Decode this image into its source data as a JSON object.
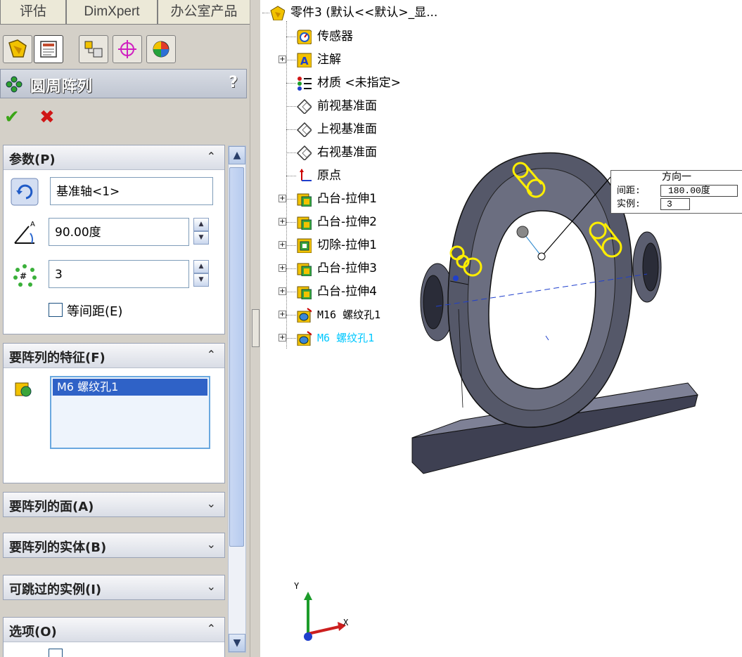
{
  "tabs": [
    "评估",
    "DimXpert",
    "办公室产品"
  ],
  "manager_icons": [
    "feature-manager-icon",
    "property-manager-icon",
    "configuration-manager-icon",
    "dimxpert-manager-icon",
    "display-manager-icon"
  ],
  "property_manager": {
    "title": "圆周阵列",
    "help": "?",
    "ok_glyph": "✔",
    "cancel_glyph": "✖",
    "parameters": {
      "header": "参数(P)",
      "axis_value": "基准轴<1>",
      "angle_value": "90.00度",
      "instances_value": "3",
      "equal_spacing_label": "等间距(E)",
      "equal_spacing_checked": false
    },
    "features_group": {
      "header": "要阵列的特征(F)",
      "items": [
        "M6 螺纹孔1"
      ]
    },
    "faces_group": {
      "header": "要阵列的面(A)"
    },
    "bodies_group": {
      "header": "要阵列的实体(B)"
    },
    "skip_group": {
      "header": "可跳过的实例(I)"
    },
    "options_group": {
      "header": "选项(O)"
    },
    "collapse_glyph": "⌃",
    "expand_glyph": "⌄"
  },
  "tree": {
    "root": "零件3  (默认<<默认>_显...",
    "items": [
      {
        "label": "传感器",
        "icon": "sensor-icon",
        "expandable": false
      },
      {
        "label": "注解",
        "icon": "annotation-icon",
        "expandable": true
      },
      {
        "label": "材质 <未指定>",
        "icon": "material-icon",
        "expandable": false
      },
      {
        "label": "前视基准面",
        "icon": "plane-icon",
        "expandable": false
      },
      {
        "label": "上视基准面",
        "icon": "plane-icon",
        "expandable": false
      },
      {
        "label": "右视基准面",
        "icon": "plane-icon",
        "expandable": false
      },
      {
        "label": "原点",
        "icon": "origin-icon",
        "expandable": false
      },
      {
        "label": "凸台-拉伸1",
        "icon": "boss-extrude-icon",
        "expandable": true
      },
      {
        "label": "凸台-拉伸2",
        "icon": "boss-extrude-icon",
        "expandable": true
      },
      {
        "label": "切除-拉伸1",
        "icon": "cut-extrude-icon",
        "expandable": true
      },
      {
        "label": "凸台-拉伸3",
        "icon": "boss-extrude-icon",
        "expandable": true
      },
      {
        "label": "凸台-拉伸4",
        "icon": "boss-extrude-icon",
        "expandable": true
      },
      {
        "label": "M16 螺纹孔1",
        "icon": "hole-wizard-icon",
        "expandable": true
      },
      {
        "label": "M6 螺纹孔1",
        "icon": "hole-wizard-icon",
        "expandable": true,
        "selected": true
      }
    ]
  },
  "callout": {
    "title": "方向一",
    "spacing_label": "间距:",
    "spacing_value": "180.00度",
    "instances_label": "实例:",
    "instances_value": "3"
  },
  "triad": {
    "x": "X",
    "y": "Y"
  },
  "colors": {
    "selected_text": "#00c8ff",
    "highlight": "#ffee00",
    "part_body": "#4a4c5c"
  }
}
